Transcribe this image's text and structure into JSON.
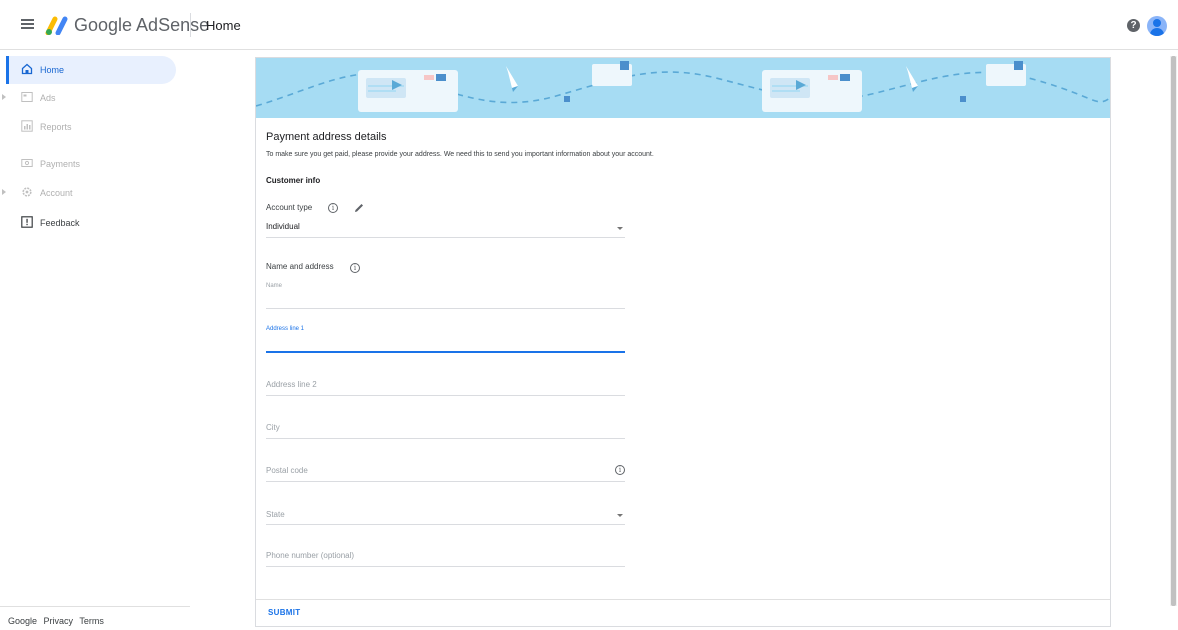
{
  "app": {
    "product_name": "Google AdSense",
    "page_title": "Home",
    "help_icon": "?"
  },
  "sidebar": {
    "items": [
      {
        "label": "Home",
        "icon": "home-icon",
        "state": "active"
      },
      {
        "label": "Ads",
        "icon": "ads-icon",
        "state": "disabled"
      },
      {
        "label": "Reports",
        "icon": "reports-icon",
        "state": "disabled"
      },
      {
        "label": "Payments",
        "icon": "payments-icon",
        "state": "disabled"
      },
      {
        "label": "Account",
        "icon": "account-icon",
        "state": "disabled"
      },
      {
        "label": "Feedback",
        "icon": "feedback-icon",
        "state": "enabled"
      }
    ],
    "footer_links": [
      "Google",
      "Privacy",
      "Terms"
    ]
  },
  "form": {
    "heading": "Payment address details",
    "description": "To make sure you get paid, please provide your address. We need this to send you important information about your account.",
    "section_title": "Customer info",
    "account_type_label": "Account type",
    "account_type_value": "Individual",
    "name_address_label": "Name and address",
    "fields": {
      "name": "Name",
      "address1": "Address line 1",
      "address2": "Address line 2",
      "city": "City",
      "postal": "Postal code",
      "state": "State",
      "phone": "Phone number (optional)"
    },
    "info_glyph": "i",
    "submit_label": "SUBMIT"
  },
  "colors": {
    "accent": "#1a73e8",
    "banner": "#a6dcf3",
    "active_nav_bg": "#e8f0fe"
  }
}
